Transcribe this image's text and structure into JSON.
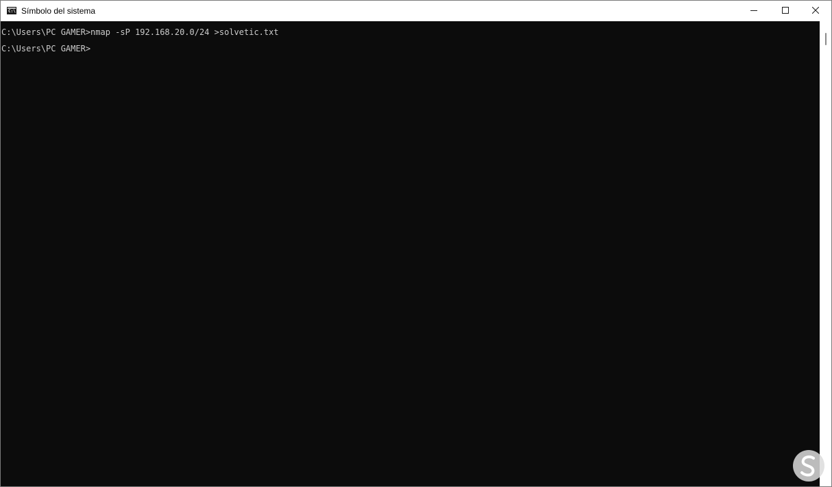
{
  "window": {
    "title": "Símbolo del sistema",
    "icon_name": "cmd-icon",
    "icon_glyph": "C:\\"
  },
  "caption": {
    "minimize_icon": "minimize-icon",
    "maximize_icon": "maximize-icon",
    "close_icon": "close-icon"
  },
  "console": {
    "lines": [
      "C:\\Users\\PC GAMER>nmap -sP 192.168.20.0/24 >solvetic.txt",
      "C:\\Users\\PC GAMER>"
    ],
    "background_color": "#0c0c0c",
    "text_color": "#cccccc"
  }
}
